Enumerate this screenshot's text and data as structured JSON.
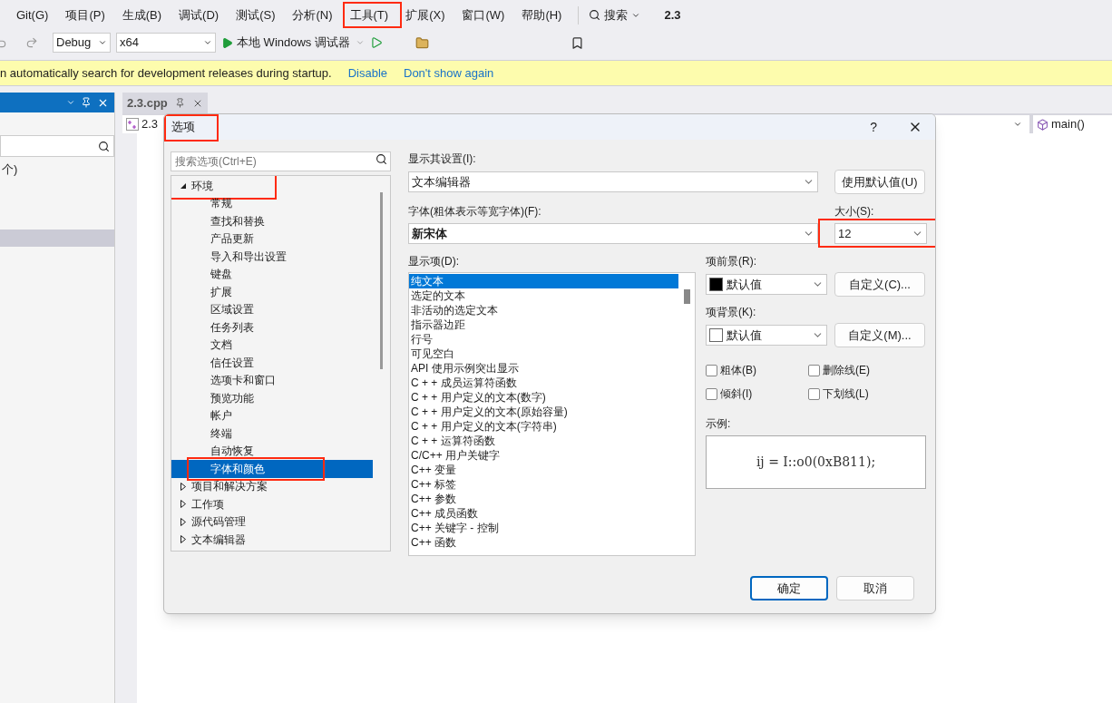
{
  "menu": [
    {
      "label": "Git(G)",
      "highlighted": false
    },
    {
      "label": "项目(P)",
      "highlighted": false
    },
    {
      "label": "生成(B)",
      "highlighted": false
    },
    {
      "label": "调试(D)",
      "highlighted": false
    },
    {
      "label": "测试(S)",
      "highlighted": false
    },
    {
      "label": "分析(N)",
      "highlighted": false
    },
    {
      "label": "工具(T)",
      "highlighted": true
    },
    {
      "label": "扩展(X)",
      "highlighted": false
    },
    {
      "label": "窗口(W)",
      "highlighted": false
    },
    {
      "label": "帮助(H)",
      "highlighted": false
    }
  ],
  "search_menu": "搜索",
  "solution_name": "2.3",
  "toolbar": {
    "configuration": "Debug",
    "platform": "x64",
    "run_label": "本地 Windows 调试器"
  },
  "info_bar": {
    "message": "n automatically search for development releases during startup.",
    "links": [
      "Disable",
      "Don't show again"
    ]
  },
  "side_panel": {
    "item_text": "个)"
  },
  "editor": {
    "tab": "2.3.cpp",
    "file_scope": "2.3",
    "member": "main()"
  },
  "dialog": {
    "title": "选项",
    "title_highlighted": true,
    "help": "?",
    "search_placeholder": "搜索选项(Ctrl+E)",
    "tree": [
      {
        "label": "环境",
        "expanded": true,
        "selected": false,
        "highlighted": true,
        "children": [
          {
            "label": "常规",
            "selected": false,
            "highlighted": false
          },
          {
            "label": "查找和替换",
            "selected": false,
            "highlighted": false
          },
          {
            "label": "产品更新",
            "selected": false,
            "highlighted": false
          },
          {
            "label": "导入和导出设置",
            "selected": false,
            "highlighted": false
          },
          {
            "label": "键盘",
            "selected": false,
            "highlighted": false
          },
          {
            "label": "扩展",
            "selected": false,
            "highlighted": false
          },
          {
            "label": "区域设置",
            "selected": false,
            "highlighted": false
          },
          {
            "label": "任务列表",
            "selected": false,
            "highlighted": false
          },
          {
            "label": "文档",
            "selected": false,
            "highlighted": false
          },
          {
            "label": "信任设置",
            "selected": false,
            "highlighted": false
          },
          {
            "label": "选项卡和窗口",
            "selected": false,
            "highlighted": false
          },
          {
            "label": "预览功能",
            "selected": false,
            "highlighted": false
          },
          {
            "label": "帐户",
            "selected": false,
            "highlighted": false
          },
          {
            "label": "终端",
            "selected": false,
            "highlighted": false
          },
          {
            "label": "自动恢复",
            "selected": false,
            "highlighted": false
          },
          {
            "label": "字体和颜色",
            "selected": true,
            "highlighted": true
          }
        ]
      },
      {
        "label": "项目和解决方案",
        "expanded": false,
        "selected": false,
        "highlighted": false
      },
      {
        "label": "工作项",
        "expanded": false,
        "selected": false,
        "highlighted": false
      },
      {
        "label": "源代码管理",
        "expanded": false,
        "selected": false,
        "highlighted": false
      },
      {
        "label": "文本编辑器",
        "expanded": false,
        "selected": false,
        "highlighted": false
      }
    ],
    "show_settings_for": {
      "label": "显示其设置(I):",
      "value": "文本编辑器"
    },
    "use_defaults": "使用默认值(U)",
    "font": {
      "label": "字体(粗体表示等宽字体)(F):",
      "value": "新宋体"
    },
    "size": {
      "label": "大小(S):",
      "value": "12",
      "highlighted": true
    },
    "display_items": {
      "label": "显示项(D):",
      "items": [
        {
          "label": "纯文本",
          "selected": true
        },
        {
          "label": "选定的文本",
          "selected": false
        },
        {
          "label": "非活动的选定文本",
          "selected": false
        },
        {
          "label": "指示器边距",
          "selected": false
        },
        {
          "label": "行号",
          "selected": false
        },
        {
          "label": "可见空白",
          "selected": false
        },
        {
          "label": "API 使用示例突出显示",
          "selected": false
        },
        {
          "label": "C + + 成员运算符函数",
          "selected": false
        },
        {
          "label": "C + + 用户定义的文本(数字)",
          "selected": false
        },
        {
          "label": "C + + 用户定义的文本(原始容量)",
          "selected": false
        },
        {
          "label": "C + + 用户定义的文本(字符串)",
          "selected": false
        },
        {
          "label": "C + + 运算符函数",
          "selected": false
        },
        {
          "label": "C/C++ 用户关键字",
          "selected": false
        },
        {
          "label": "C++ 变量",
          "selected": false
        },
        {
          "label": "C++ 标签",
          "selected": false
        },
        {
          "label": "C++ 参数",
          "selected": false
        },
        {
          "label": "C++ 成员函数",
          "selected": false
        },
        {
          "label": "C++ 关键字 - 控制",
          "selected": false
        },
        {
          "label": "C++ 函数",
          "selected": false
        }
      ]
    },
    "foreground": {
      "label": "项前景(R):",
      "value": "默认值",
      "color": "#000000",
      "button": "自定义(C)..."
    },
    "background": {
      "label": "项背景(K):",
      "value": "默认值",
      "color": "#ffffff",
      "button": "自定义(M)..."
    },
    "checkboxes": [
      {
        "label": "粗体(B)",
        "checked": false
      },
      {
        "label": "删除线(E)",
        "checked": false
      },
      {
        "label": "倾斜(I)",
        "checked": false
      },
      {
        "label": "下划线(L)",
        "checked": false
      }
    ],
    "sample_label": "示例:",
    "sample": "ij = I::o0(0xB811);",
    "buttons": [
      {
        "label": "确定",
        "default": true
      },
      {
        "label": "取消",
        "default": false
      }
    ]
  }
}
